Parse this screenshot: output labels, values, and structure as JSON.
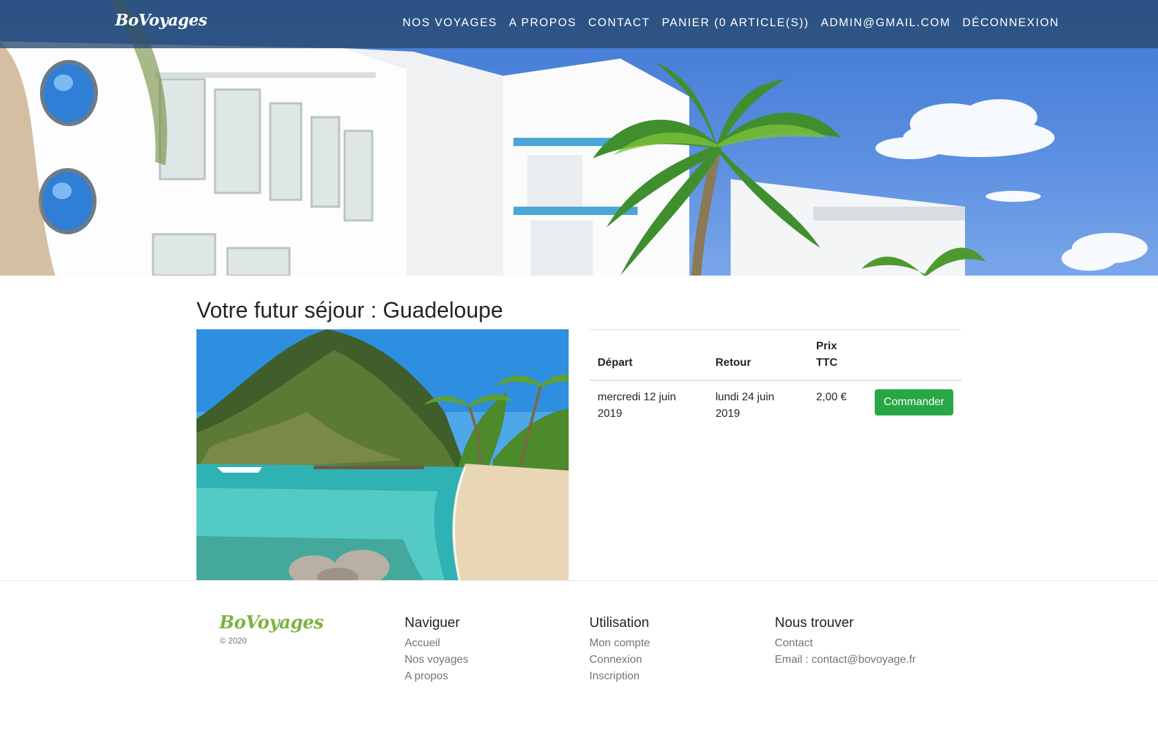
{
  "navbar": {
    "brand": "BoVoyages",
    "links": [
      "Nos voyages",
      "A propos",
      "Contact",
      "Panier (0 article(s))",
      "admin@gmail.com",
      "Déconnexion"
    ]
  },
  "main": {
    "title": "Votre futur séjour : Guadeloupe",
    "table": {
      "headers": [
        "Départ",
        "Retour",
        "Prix TTC"
      ],
      "rows": [
        {
          "depart": "mercredi 12 juin 2019",
          "retour": "lundi 24 juin 2019",
          "prix": "2,00 €",
          "action": "Commander"
        }
      ]
    }
  },
  "footer": {
    "brand": "BoVoyages",
    "copyright": "© 2020",
    "columns": [
      {
        "title": "Naviguer",
        "links": [
          "Accueil",
          "Nos voyages",
          "A propos"
        ]
      },
      {
        "title": "Utilisation",
        "links": [
          "Mon compte",
          "Connexion",
          "Inscription"
        ]
      },
      {
        "title": "Nous trouver",
        "links": [
          "Contact",
          "Email : contact@bovoyage.fr"
        ]
      }
    ]
  },
  "colors": {
    "navbar": "#28486e",
    "button": "#28a745",
    "footer_brand": "#7cb342"
  }
}
